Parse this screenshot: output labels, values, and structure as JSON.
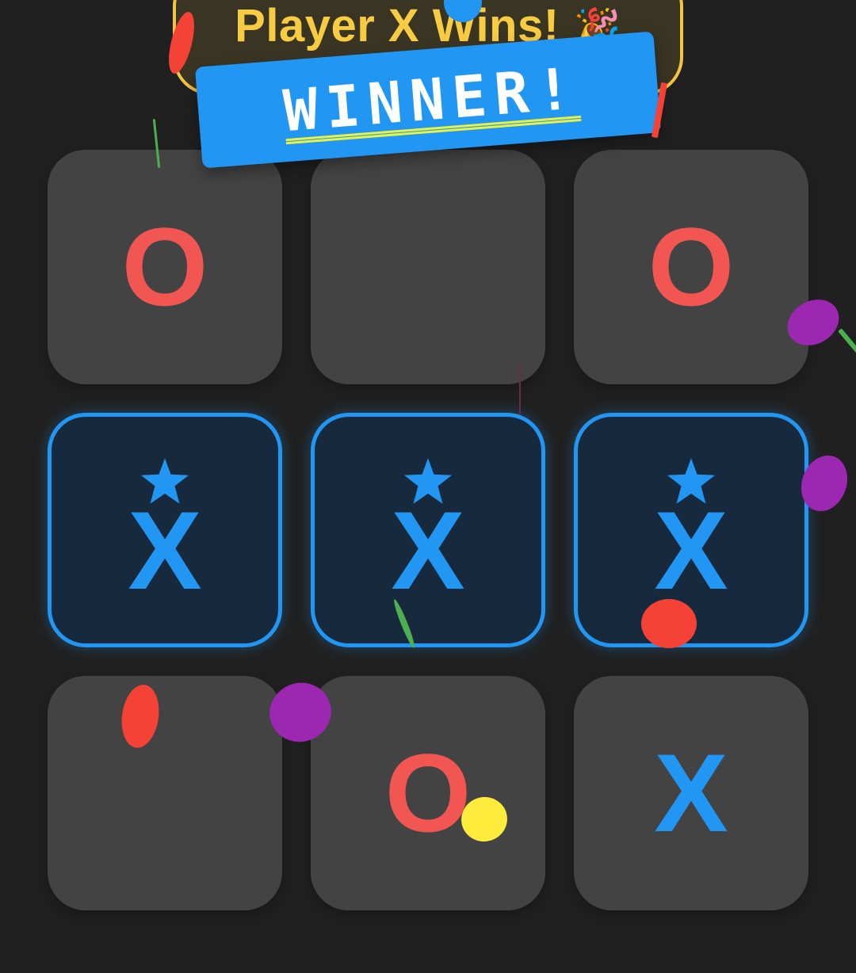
{
  "status": {
    "text": "Player X Wins!",
    "emoji": "🎉"
  },
  "banner": {
    "text": "WINNER!"
  },
  "board": {
    "cells": [
      {
        "mark": "O",
        "winning": false
      },
      {
        "mark": "",
        "winning": false
      },
      {
        "mark": "O",
        "winning": false
      },
      {
        "mark": "X",
        "winning": true
      },
      {
        "mark": "X",
        "winning": true
      },
      {
        "mark": "X",
        "winning": true
      },
      {
        "mark": "",
        "winning": false
      },
      {
        "mark": "O",
        "winning": false
      },
      {
        "mark": "X",
        "winning": false
      }
    ]
  },
  "colors": {
    "background": "#202020",
    "x": "#2196f3",
    "o": "#f25653",
    "highlight": "#f0c541",
    "cell": "#434343",
    "win_cell": "#172a3d"
  }
}
